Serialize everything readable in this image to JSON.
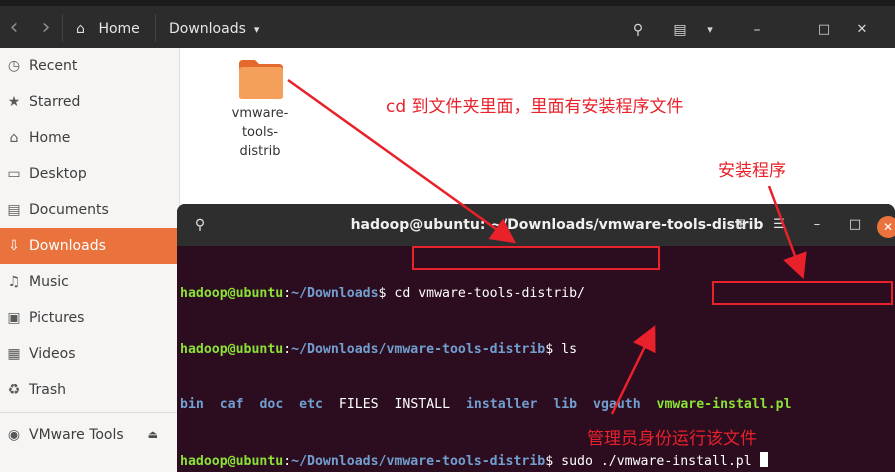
{
  "header": {
    "back_icon": "chevron-left-icon",
    "forward_icon": "chevron-right-icon",
    "home_icon": "home-icon",
    "breadcrumb_home": "Home",
    "breadcrumb_current": "Downloads",
    "breadcrumb_caret": "▾",
    "search_icon": "search-icon",
    "view_icon": "list-view-icon",
    "menu_caret": "▾",
    "minimize": "–",
    "maximize": "□",
    "close": "✕"
  },
  "sidebar": {
    "items": [
      {
        "label": "Recent",
        "icon": "clock-icon",
        "glyph": "◷"
      },
      {
        "label": "Starred",
        "icon": "star-icon",
        "glyph": "★"
      },
      {
        "label": "Home",
        "icon": "home-icon",
        "glyph": "⌂"
      },
      {
        "label": "Desktop",
        "icon": "desktop-icon",
        "glyph": "▭"
      },
      {
        "label": "Documents",
        "icon": "document-icon",
        "glyph": "▤"
      },
      {
        "label": "Downloads",
        "icon": "download-icon",
        "glyph": "⇩",
        "active": true
      },
      {
        "label": "Music",
        "icon": "music-icon",
        "glyph": "♫"
      },
      {
        "label": "Pictures",
        "icon": "picture-icon",
        "glyph": "▣"
      },
      {
        "label": "Videos",
        "icon": "video-icon",
        "glyph": "▦"
      },
      {
        "label": "Trash",
        "icon": "trash-icon",
        "glyph": "♻"
      }
    ],
    "device": {
      "label": "VMware Tools",
      "icon": "disc-icon",
      "glyph": "◉",
      "eject": "⏏"
    }
  },
  "content": {
    "folder": {
      "name": "vmware-tools-distrib",
      "name_lines": [
        "vmware-",
        "tools-",
        "distrib"
      ]
    }
  },
  "terminal": {
    "title": "hadoop@ubuntu: ~/Downloads/vmware-tools-distrib",
    "new_tab_icon": "⊞",
    "menu_icon": "☰",
    "minimize": "–",
    "maximize": "□",
    "close": "✕",
    "lines": [
      {
        "user": "hadoop@ubuntu",
        "colon": ":",
        "path": "~/Downloads",
        "prompt": "$ ",
        "cmd": "cd vmware-tools-distrib/"
      },
      {
        "user": "hadoop@ubuntu",
        "colon": ":",
        "path": "~/Downloads/vmware-tools-distrib",
        "prompt": "$ ",
        "cmd": "ls"
      },
      {
        "user": "hadoop@ubuntu",
        "colon": ":",
        "path": "~/Downloads/vmware-tools-distrib",
        "prompt": "$ ",
        "cmd": "sudo ./vmware-install.pl "
      }
    ],
    "ls_output": [
      {
        "name": "bin",
        "kind": "dir"
      },
      {
        "name": "caf",
        "kind": "dir"
      },
      {
        "name": "doc",
        "kind": "dir"
      },
      {
        "name": "etc",
        "kind": "dir"
      },
      {
        "name": "FILES",
        "kind": "file"
      },
      {
        "name": "INSTALL",
        "kind": "file"
      },
      {
        "name": "installer",
        "kind": "dir"
      },
      {
        "name": "lib",
        "kind": "dir"
      },
      {
        "name": "vgauth",
        "kind": "dir"
      },
      {
        "name": "vmware-install.pl",
        "kind": "exec"
      }
    ]
  },
  "annotations": {
    "cd_note": "cd 到文件夹里面，里面有安装程序文件",
    "installer_note": "安装程序",
    "sudo_note": "管理员身份运行该文件"
  },
  "colors": {
    "accent": "#e9723d",
    "terminal_bg": "#2c0d20",
    "prompt_green": "#8ae234",
    "path_blue": "#729fcf",
    "annotation_red": "#e8212a"
  }
}
